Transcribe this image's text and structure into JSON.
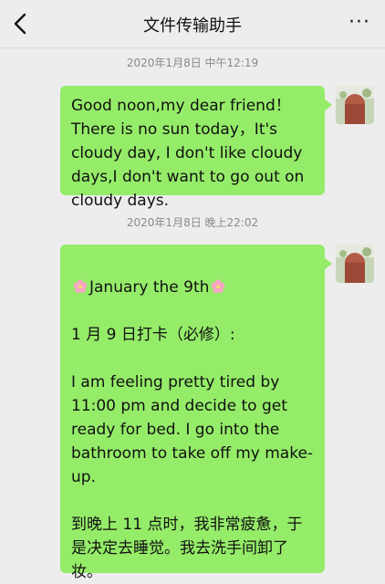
{
  "header": {
    "title": "文件传输助手",
    "more_label": "···"
  },
  "messages": [
    {
      "timestamp": "2020年1月8日 中午12:19",
      "text": "Good noon,my dear friend！There is no sun today，It's cloudy day, I don't like cloudy days,I don't want to go out on cloudy days."
    },
    {
      "timestamp": "2020年1月8日 晚上22:02",
      "heading": "January the 9th",
      "line2": "1 月 9 日打卡（必修）:",
      "para_en": "I am feeling pretty tired by 11:00 pm and decide to get ready for bed. I go into the bathroom to take off my make-up.",
      "para_zh": "到晚上 11 点时，我非常疲惫，于是决定去睡觉。我去洗手间卸了妆。"
    }
  ],
  "icons": {
    "back": "chevron-left-icon",
    "more": "more-dots-icon",
    "flower": "cherry-blossom-emoji"
  },
  "colors": {
    "background": "#ededed",
    "bubble": "#95ec69",
    "timestamp": "#8a8a8a"
  }
}
